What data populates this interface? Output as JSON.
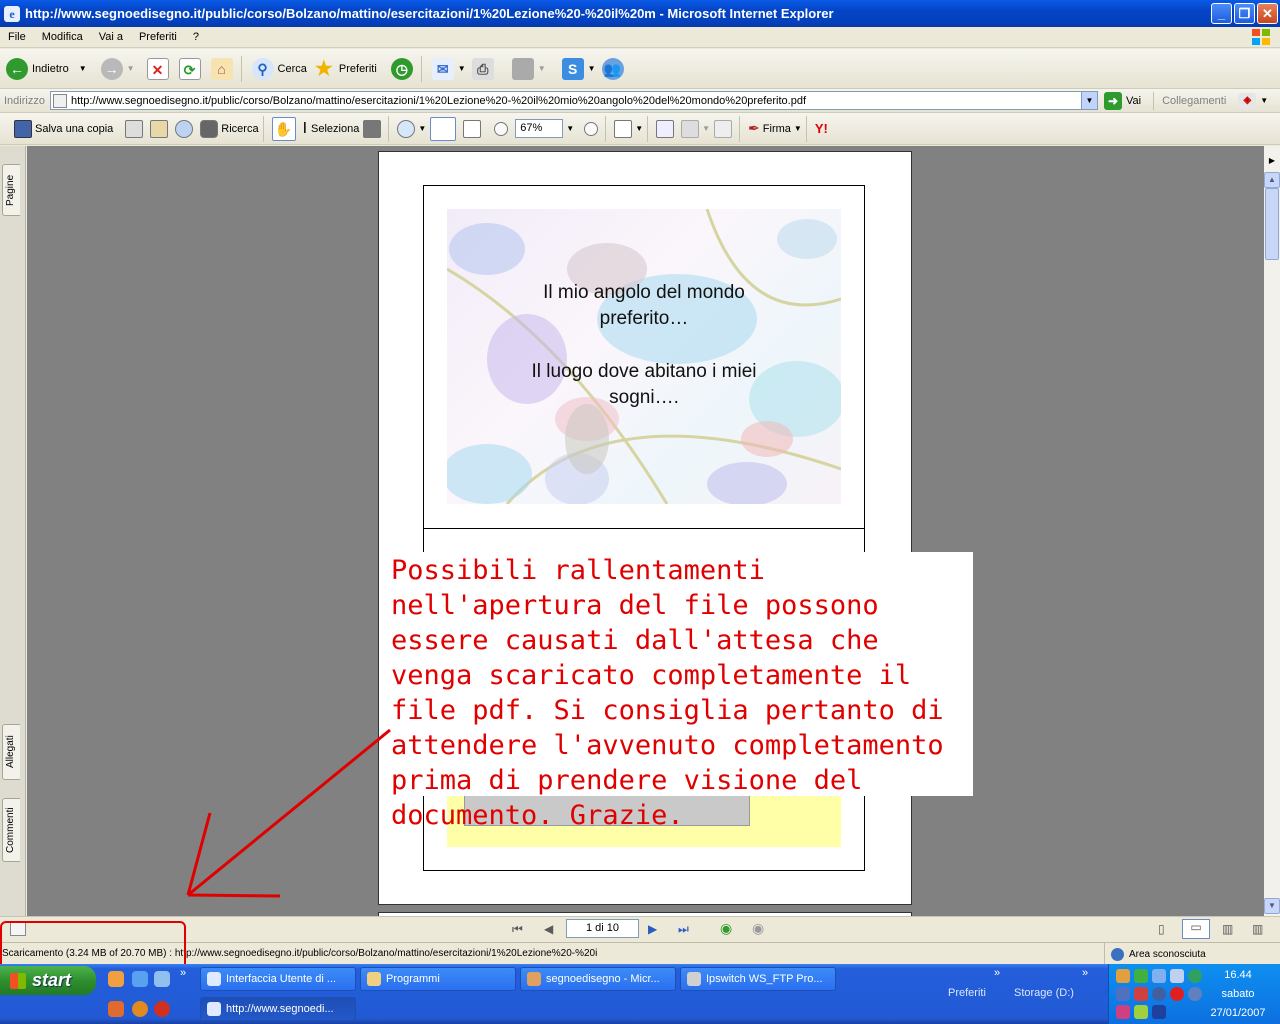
{
  "window": {
    "title": "http://www.segnoedisegno.it/public/corso/Bolzano/mattino/esercitazioni/1%20Lezione%20-%20il%20m - Microsoft Internet Explorer",
    "minimize": "_",
    "maximize": "❐",
    "close": "✕"
  },
  "menu": [
    "File",
    "Modifica",
    "Vai a",
    "Preferiti",
    "?"
  ],
  "toolbar": {
    "back_label": "Indietro",
    "search_label": "Cerca",
    "favorites_label": "Preferiti"
  },
  "address": {
    "label": "Indirizzo",
    "url": "http://www.segnoedisegno.it/public/corso/Bolzano/mattino/esercitazioni/1%20Lezione%20-%20il%20mio%20angolo%20del%20mondo%20preferito.pdf",
    "go_label": "Vai",
    "links_label": "Collegamenti"
  },
  "pdf_toolbar": {
    "save_copy_label": "Salva una copia",
    "search_label": "Ricerca",
    "select_label": "Seleziona",
    "zoom_value": "67%",
    "sign_label": "Firma"
  },
  "side_tabs": {
    "pages": "Pagine",
    "attachments": "Allegati",
    "comments": "Commenti"
  },
  "slide": {
    "line1": "Il mio angolo del mondo",
    "line2": "preferito…",
    "line3": "Il luogo dove abitano i miei",
    "line4": "sogni…."
  },
  "callout": {
    "text": "Possibili rallentamenti nell'apertura del file possono essere causati dall'attesa che venga scaricato completamente il file pdf. Si consiglia pertanto di attendere l'avvenuto completamento prima di prendere visione del documento. Grazie.",
    "color": "#e00000"
  },
  "pdf_nav": {
    "page_indicator": "1 di 10"
  },
  "status": {
    "text": "Scaricamento (3.24 MB of 20.70 MB) : http://www.segnoedisegno.it/public/corso/Bolzano/mattino/esercitazioni/1%20Lezione%20-%20i",
    "zone": "Area sconosciuta"
  },
  "taskbar": {
    "start_label": "start",
    "tasks_row1": [
      "Interfaccia Utente di ...",
      "Programmi",
      "segnoedisegno - Micr...",
      "Ipswitch WS_FTP Pro..."
    ],
    "tasks_row2": [
      "http://www.segnoedi..."
    ],
    "toolbar_preferiti": "Preferiti",
    "toolbar_storage": "Storage (D:)",
    "chevron": "»"
  },
  "clock": {
    "time": "16.44",
    "day": "sabato",
    "date": "27/01/2007"
  }
}
